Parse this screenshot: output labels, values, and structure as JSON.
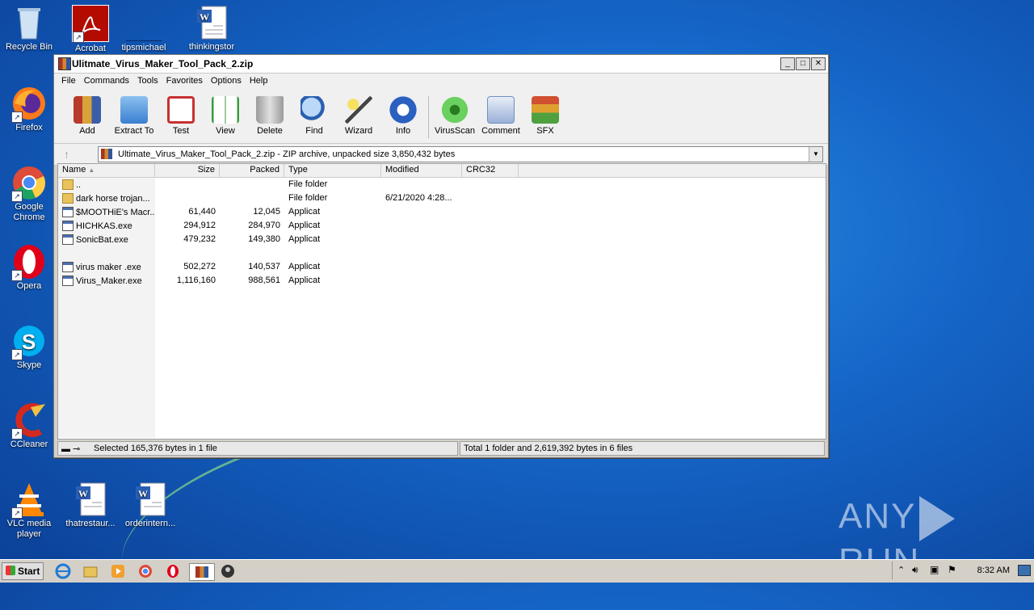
{
  "desktop": {
    "icons": [
      {
        "label": "Recycle Bin",
        "icon": "recycle-bin-icon"
      },
      {
        "label": "Acrobat",
        "icon": "acrobat-icon"
      },
      {
        "label": "tipsmichael",
        "icon": "blank-file-icon"
      },
      {
        "label": "thinkingstor",
        "icon": "word-document-icon"
      },
      {
        "label": "Firefox",
        "icon": "firefox-icon"
      },
      {
        "label": "Google Chrome",
        "icon": "chrome-icon"
      },
      {
        "label": "Opera",
        "icon": "opera-icon"
      },
      {
        "label": "Skype",
        "icon": "skype-icon"
      },
      {
        "label": "CCleaner",
        "icon": "ccleaner-icon"
      },
      {
        "label": "VLC media player",
        "icon": "vlc-icon"
      },
      {
        "label": "thatrestaur...",
        "icon": "word-document-icon"
      },
      {
        "label": "orderintern...",
        "icon": "word-document-icon"
      }
    ],
    "watermark": "ANY RUN"
  },
  "window": {
    "title": "Ulitmate_Virus_Maker_Tool_Pack_2.zip",
    "controls": {
      "minimize": "_",
      "maximize": "□",
      "close": "✕"
    },
    "menu": [
      "File",
      "Commands",
      "Tools",
      "Favorites",
      "Options",
      "Help"
    ],
    "toolbar": [
      {
        "label": "Add",
        "icon": "add-archive-icon",
        "color": "#c04020"
      },
      {
        "label": "Extract To",
        "icon": "extract-folder-icon",
        "color": "#3a7fd0"
      },
      {
        "label": "Test",
        "icon": "test-clipboard-icon",
        "color": "#c83030"
      },
      {
        "label": "View",
        "icon": "view-book-icon",
        "color": "#3a9a40"
      },
      {
        "label": "Delete",
        "icon": "trash-icon",
        "color": "#8a8a8a"
      },
      {
        "label": "Find",
        "icon": "magnifier-icon",
        "color": "#2a5fb0"
      },
      {
        "label": "Wizard",
        "icon": "wand-icon",
        "color": "#d0c040"
      },
      {
        "label": "Info",
        "icon": "info-icon",
        "color": "#2a60c0"
      },
      {
        "label": "VirusScan",
        "icon": "virus-scan-icon",
        "color": "#30a030"
      },
      {
        "label": "Comment",
        "icon": "comment-icon",
        "color": "#7090c0"
      },
      {
        "label": "SFX",
        "icon": "sfx-icon",
        "color": "#d05030"
      }
    ],
    "address": "Ultimate_Virus_Maker_Tool_Pack_2.zip - ZIP archive, unpacked size 3,850,432 bytes",
    "columns": [
      "Name",
      "Size",
      "Packed",
      "Type",
      "Modified",
      "CRC32"
    ],
    "rows": [
      {
        "name": "..",
        "size": "",
        "packed": "",
        "type": "File folder",
        "modified": "",
        "icon": "folder"
      },
      {
        "name": "dark horse trojan...",
        "size": "",
        "packed": "",
        "type": "File folder",
        "modified": "6/21/2020 4:28...",
        "icon": "folder"
      },
      {
        "name": "$MOOTHiE's Macr...",
        "size": "61,440",
        "packed": "12,045",
        "type": "Applicat",
        "modified": "",
        "icon": "exe"
      },
      {
        "name": "HICHKAS.exe",
        "size": "294,912",
        "packed": "284,970",
        "type": "Applicat",
        "modified": "",
        "icon": "exe"
      },
      {
        "name": "SonicBat.exe",
        "size": "479,232",
        "packed": "149,380",
        "type": "Applicat",
        "modified": "",
        "icon": "exe"
      },
      {
        "name": "virus maker .exe",
        "size": "502,272",
        "packed": "140,537",
        "type": "Applicat",
        "modified": "",
        "icon": "exe"
      },
      {
        "name": "Virus_Maker.exe",
        "size": "1,116,160",
        "packed": "988,561",
        "type": "Applicat",
        "modified": "",
        "icon": "exe"
      }
    ],
    "status_left": "Selected 165,376 bytes in 1 file",
    "status_right": "Total 1 folder and 2,619,392 bytes in 6 files"
  },
  "taskbar": {
    "start": "Start",
    "items": [
      "ie-icon",
      "explorer-icon",
      "media-player-icon",
      "chrome-icon",
      "opera-icon",
      "winrar-icon",
      "unknown-app-icon"
    ],
    "clock": "8:32 AM"
  }
}
